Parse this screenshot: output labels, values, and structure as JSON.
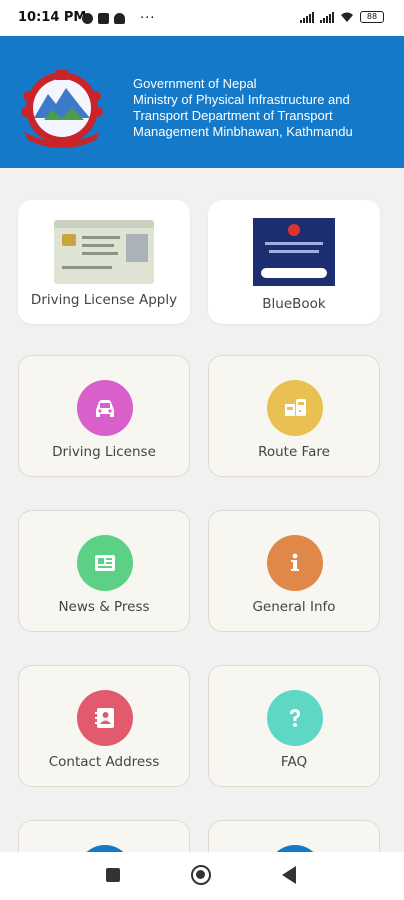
{
  "status_bar": {
    "time": "10:14 PM",
    "battery": "88"
  },
  "header": {
    "lines": [
      "Government of Nepal",
      "Ministry of Physical Infrastructure and",
      "Transport Department of Transport",
      "Management Minbhawan, Kathmandu"
    ]
  },
  "top_cards": [
    {
      "label": "Driving License Apply"
    },
    {
      "label": "BlueBook"
    }
  ],
  "menu": [
    {
      "label": "Driving License",
      "icon": "car-icon",
      "color": "#d95fcb"
    },
    {
      "label": "Route Fare",
      "icon": "bus-icon",
      "color": "#e9c152"
    },
    {
      "label": "News & Press",
      "icon": "newspaper-icon",
      "color": "#5cd186"
    },
    {
      "label": "General Info",
      "icon": "info-icon",
      "color": "#e0884a"
    },
    {
      "label": "Contact Address",
      "icon": "contact-book-icon",
      "color": "#e25a6e"
    },
    {
      "label": "FAQ",
      "icon": "question-icon",
      "color": "#5ed8c5"
    }
  ],
  "colors": {
    "header_bg": "#1479c9",
    "page_bg": "#f1f1f1",
    "partial_circle": "#1479c9"
  }
}
